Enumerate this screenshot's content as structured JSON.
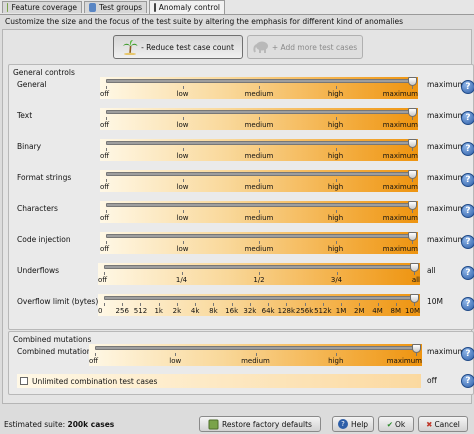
{
  "tabs": [
    {
      "label": "Feature coverage",
      "icon": "coverage-icon",
      "active": false
    },
    {
      "label": "Test groups",
      "icon": "groups-icon",
      "active": false
    },
    {
      "label": "Anomaly control",
      "icon": "anomaly-icon",
      "active": true
    }
  ],
  "subtitle": "Customize the size and the focus of the test suite by altering the emphasis for different kind of anomalies",
  "reduce_button": "- Reduce test case count",
  "more_button": "+ Add more test cases",
  "general": {
    "title": "General controls",
    "sliders": [
      {
        "label": "General",
        "max_label": "maximum",
        "level": 1.0,
        "ticks": [
          "off",
          "low",
          "medium",
          "high",
          "maximum"
        ]
      },
      {
        "label": "Text",
        "max_label": "maximum",
        "level": 1.0,
        "ticks": [
          "off",
          "low",
          "medium",
          "high",
          "maximum"
        ]
      },
      {
        "label": "Binary",
        "max_label": "maximum",
        "level": 1.0,
        "ticks": [
          "off",
          "low",
          "medium",
          "high",
          "maximum"
        ]
      },
      {
        "label": "Format strings",
        "max_label": "maximum",
        "level": 1.0,
        "ticks": [
          "off",
          "low",
          "medium",
          "high",
          "maximum"
        ]
      },
      {
        "label": "Characters",
        "max_label": "maximum",
        "level": 1.0,
        "ticks": [
          "off",
          "low",
          "medium",
          "high",
          "maximum"
        ]
      },
      {
        "label": "Code injection",
        "max_label": "maximum",
        "level": 1.0,
        "ticks": [
          "off",
          "low",
          "medium",
          "high",
          "maximum"
        ]
      },
      {
        "label": "Underflows",
        "max_label": "all",
        "level": 1.0,
        "ticks": [
          "off",
          "1/4",
          "1/2",
          "3/4",
          "all"
        ]
      },
      {
        "label": "Overflow limit (bytes)",
        "max_label": "10M",
        "level": 1.0,
        "ticks": [
          "0",
          "256",
          "512",
          "1k",
          "2k",
          "4k",
          "8k",
          "16k",
          "32k",
          "64k",
          "128k",
          "256k",
          "512k",
          "1M",
          "2M",
          "4M",
          "8M",
          "10M"
        ]
      }
    ]
  },
  "combined": {
    "title": "Combined mutations",
    "slider": {
      "label": "Combined mutations",
      "max_label": "maximum",
      "level": 1.0,
      "ticks": [
        "off",
        "low",
        "medium",
        "high",
        "maximum"
      ]
    },
    "checkbox_label": "Unlimited combination test cases",
    "checkbox_state": "off",
    "checked": false
  },
  "status": {
    "prefix": "Estimated suite:",
    "value": "200k cases"
  },
  "footer": {
    "restore": "Restore factory defaults",
    "help": "Help",
    "ok": "Ok",
    "cancel": "Cancel"
  },
  "help_glyph": "?",
  "colors": {
    "track_start": "#fff8e6",
    "track_end": "#ee9410",
    "help_blue": "#2d5ea8"
  }
}
